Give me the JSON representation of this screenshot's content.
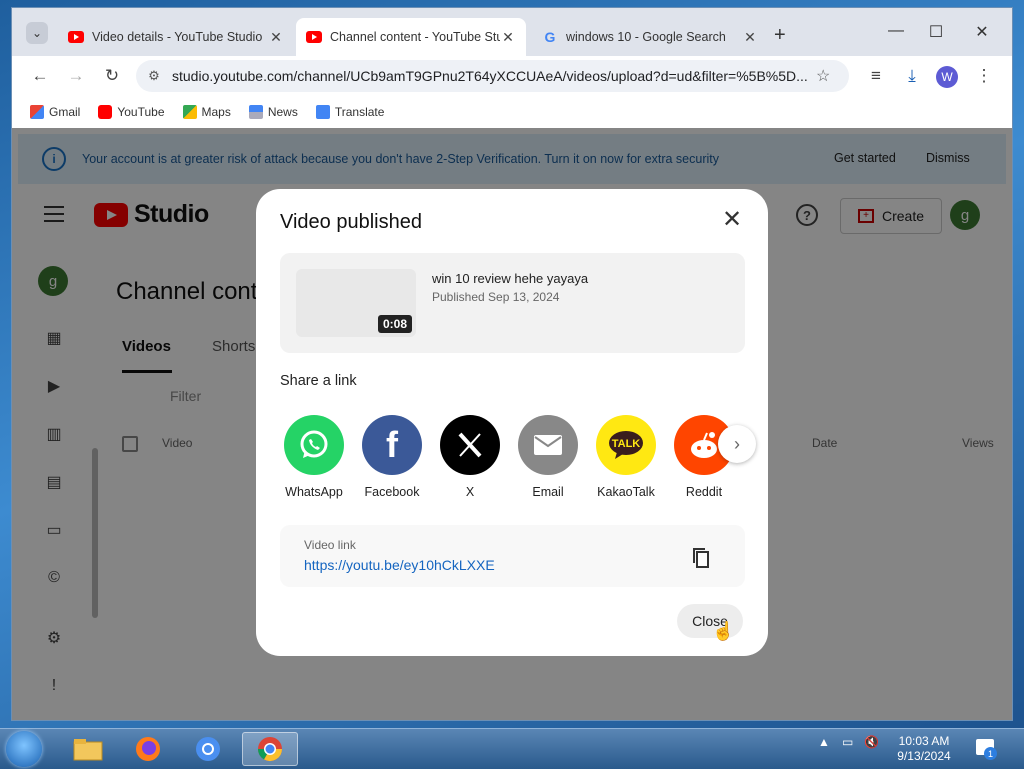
{
  "browser": {
    "tabs": [
      {
        "title": "Video details - YouTube Studio",
        "active": false
      },
      {
        "title": "Channel content - YouTube Studio",
        "active": true
      },
      {
        "title": "windows 10 - Google Search",
        "active": false
      }
    ],
    "url": "studio.youtube.com/channel/UCb9amT9GPnu2T64yXCCUAeA/videos/upload?d=ud&filter=%5B%5D...",
    "profile_initial": "W",
    "bookmarks": [
      "Gmail",
      "YouTube",
      "Maps",
      "News",
      "Translate"
    ]
  },
  "banner": {
    "message": "Your account is at greater risk of attack because you don't have 2-Step Verification. Turn it on now for extra security",
    "get_started": "Get started",
    "dismiss": "Dismiss"
  },
  "studio": {
    "logo_text": "Studio",
    "create_label": "Create",
    "avatar_initial": "g",
    "page_title": "Channel content",
    "tabs": [
      "Videos",
      "Shorts"
    ],
    "filter_placeholder": "Filter",
    "columns": {
      "video": "Video",
      "date": "Date",
      "views": "Views"
    }
  },
  "modal": {
    "title": "Video published",
    "video": {
      "title": "win 10 review hehe yayaya",
      "published": "Published Sep 13, 2024",
      "duration": "0:08"
    },
    "share_heading": "Share a link",
    "share_targets": [
      {
        "label": "WhatsApp",
        "color": "#25d366"
      },
      {
        "label": "Facebook",
        "color": "#3b5998"
      },
      {
        "label": "X",
        "color": "#000000"
      },
      {
        "label": "Email",
        "color": "#888888"
      },
      {
        "label": "KakaoTalk",
        "color": "#ffe812"
      },
      {
        "label": "Reddit",
        "color": "#ff4500"
      }
    ],
    "link_label": "Video link",
    "link_url": "https://youtu.be/ey10hCkLXXE",
    "close_label": "Close"
  },
  "taskbar": {
    "time": "10:03 AM",
    "date": "9/13/2024",
    "notifications": "1"
  }
}
